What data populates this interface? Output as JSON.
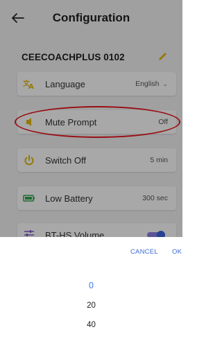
{
  "header": {
    "title": "Configuration"
  },
  "device": {
    "name": "CEECOACHPLUS 0102"
  },
  "settings": [
    {
      "label": "Language",
      "value": "English",
      "icon": "translate-icon"
    },
    {
      "label": "Mute Prompt",
      "value": "Off",
      "icon": "speaker-icon"
    },
    {
      "label": "Switch Off",
      "value": "5 min",
      "icon": "power-icon"
    },
    {
      "label": "Low Battery",
      "value": "300 sec",
      "icon": "battery-icon"
    },
    {
      "label": "BT-HS Volume",
      "icon": "sliders-icon",
      "toggle_on": true
    }
  ],
  "picker": {
    "cancel_label": "CANCEL",
    "ok_label": "OK",
    "options": [
      "0",
      "20",
      "40"
    ],
    "selected": "0"
  },
  "colors": {
    "accent": "#3d6ad9",
    "icon_yellow": "#e3b80f",
    "icon_green": "#2fa44a",
    "icon_purple": "#7a55c9",
    "highlight": "#e8141b"
  }
}
